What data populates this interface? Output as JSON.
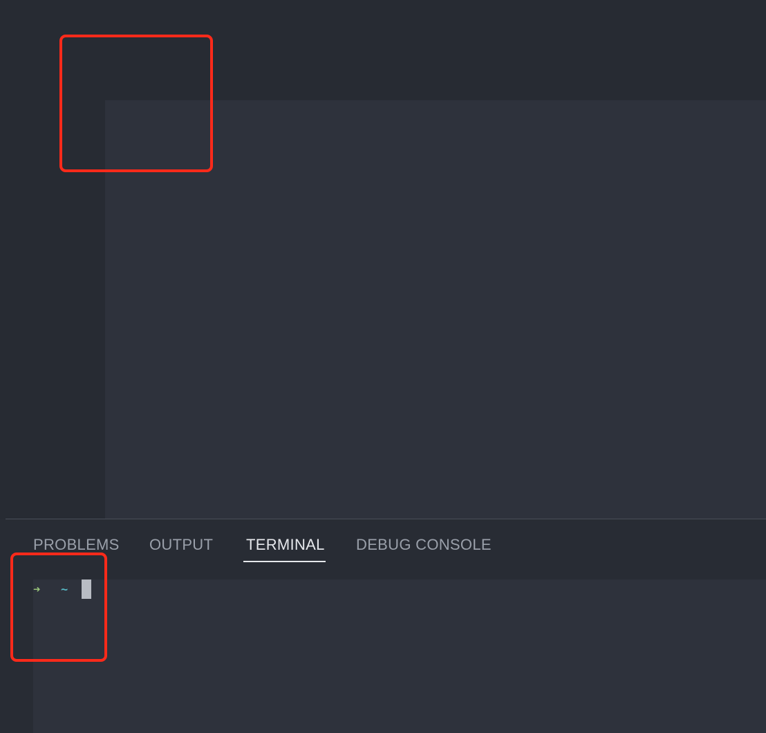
{
  "panel": {
    "tabs": [
      {
        "label": "PROBLEMS",
        "active": false
      },
      {
        "label": "OUTPUT",
        "active": false
      },
      {
        "label": "TERMINAL",
        "active": true
      },
      {
        "label": "DEBUG CONSOLE",
        "active": false
      }
    ]
  },
  "terminal": {
    "prompt_arrow": "➜",
    "prompt_path": "~"
  },
  "colors": {
    "background": "#282c34",
    "editor": "#2e323c",
    "prompt_arrow": "#98c379",
    "prompt_path": "#56b6c2",
    "highlight": "#ff2a1a",
    "active_tab": "#e6e8ec",
    "inactive_tab": "#9aa0aa"
  }
}
